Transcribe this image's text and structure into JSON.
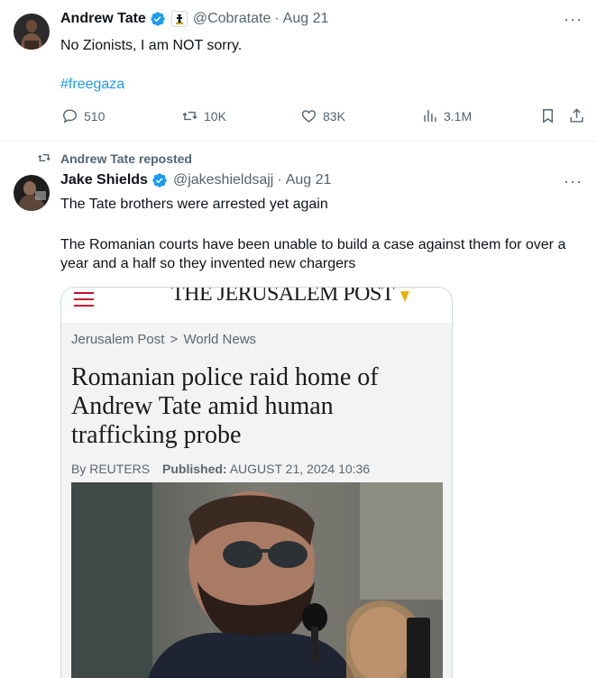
{
  "tweet1": {
    "author_name": "Andrew Tate",
    "handle": "@Cobratate",
    "date": "Aug 21",
    "sep": "·",
    "text": "No Zionists, I am NOT sorry.",
    "hashtag": "#freegaza",
    "more": "···",
    "counts": {
      "replies": "510",
      "reposts": "10K",
      "likes": "83K",
      "views": "3.1M"
    }
  },
  "repost_banner": {
    "text": "Andrew Tate reposted"
  },
  "tweet2": {
    "author_name": "Jake Shields",
    "handle": "@jakeshieldsajj",
    "date": "Aug 21",
    "sep": "·",
    "more": "···",
    "line1": "The Tate brothers were arrested yet again",
    "line2": "The Romanian courts have been unable to build a case against them for over a year and a half so they invented new chargers"
  },
  "card": {
    "masthead": "THE JERUSALEM POST",
    "breadcrumb_a": "Jerusalem Post",
    "breadcrumb_sep": ">",
    "breadcrumb_b": "World News",
    "headline": "Romanian police raid home of Andrew Tate amid human trafficking probe",
    "byline_prefix": "By REUTERS",
    "published_label": "Published:",
    "published_date": "AUGUST 21, 2024 10:36"
  },
  "colors": {
    "verified": "#1d9bf0",
    "text": "#0f1419",
    "secondary": "#536471",
    "link": "#1d9bf0",
    "jpost_red": "#c8102e"
  }
}
